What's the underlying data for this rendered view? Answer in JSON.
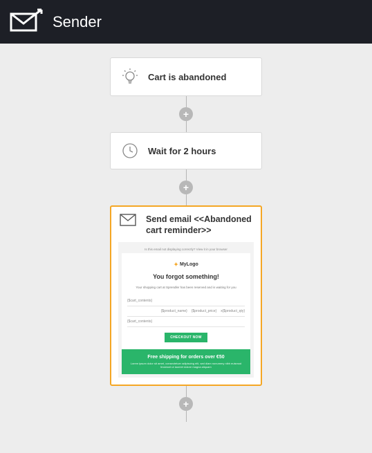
{
  "header": {
    "brand": "Sender"
  },
  "nodes": {
    "trigger": {
      "label": "Cart is abandoned"
    },
    "wait": {
      "label": "Wait for 2 hours"
    },
    "email": {
      "title": "Send email <<Abandoned cart reminder>>",
      "preview": {
        "topbar": "Is this email not displaying correctly? View it in your browser",
        "logo": "MyLogo",
        "headline": "You forgot something!",
        "subtext": "Your shopping cart at Sprendler has been reserved and is waiting for you",
        "placeholder1": "{$cart_contents}",
        "col1": "{$product_name}",
        "col2": "{$product_price}",
        "col3": "x{$product_qty}",
        "placeholder2": "{$cart_contents}",
        "cta": "CHECKOUT NOW",
        "banner_title": "Free shipping for orders over €50",
        "banner_text": "Lorem ipsum dolor sit amet, consectetuer adipiscing elit, sed diam nonummy nibh euismod tincidunt ut laoreet dolore magna aliquam"
      }
    }
  }
}
